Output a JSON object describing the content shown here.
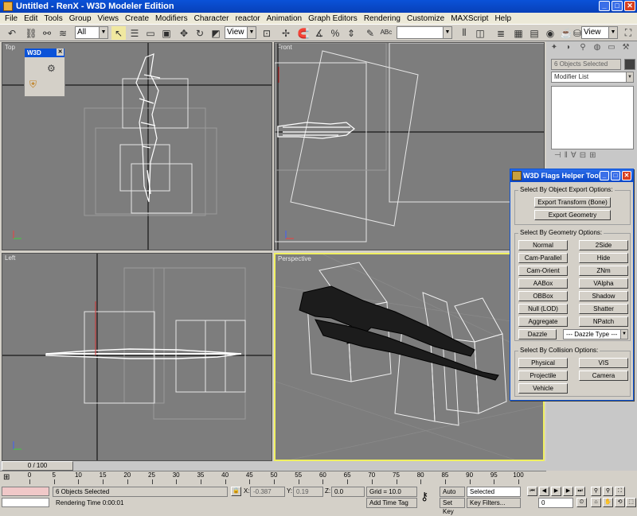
{
  "window": {
    "title": "Untitled - RenX - W3D Modeler Edition"
  },
  "menu": [
    "File",
    "Edit",
    "Tools",
    "Group",
    "Views",
    "Create",
    "Modifiers",
    "Character",
    "reactor",
    "Animation",
    "Graph Editors",
    "Rendering",
    "Customize",
    "MAXScript",
    "Help"
  ],
  "toolbar": {
    "selection_filter": "All",
    "ref_coord": "View",
    "named_sel": "",
    "render_type": "View"
  },
  "viewports": {
    "top": "Top",
    "front": "Front",
    "left": "Left",
    "perspective": "Perspective"
  },
  "w3d_mini": {
    "title": "W3D"
  },
  "command_panel": {
    "selection_label": "6 Objects Selected",
    "modifier_list": "Modifier List"
  },
  "flags_dialog": {
    "title": "W3D Flags Helper Tool",
    "group_export": "Select By Object Export Options:",
    "btn_export_transform": "Export Transform (Bone)",
    "btn_export_geometry": "Export Geometry",
    "group_geometry": "Select By Geometry Options:",
    "geo_buttons": [
      "Normal",
      "2Side",
      "Cam-Parallel",
      "Hide",
      "Cam-Orient",
      "ZNm",
      "AABox",
      "VAlpha",
      "OBBox",
      "Shadow",
      "Null (LOD)",
      "Shatter",
      "Aggregate",
      "NPatch"
    ],
    "btn_dazzle": "Dazzle",
    "dazzle_type": "--- Dazzle Type ---",
    "group_collision": "Select By Collision Options:",
    "col_buttons": [
      "Physical",
      "VIS",
      "Projectile",
      "Camera"
    ],
    "btn_vehicle": "Vehicle"
  },
  "timeline": {
    "frame": "0 / 100",
    "ticks": [
      "0",
      "5",
      "10",
      "15",
      "20",
      "25",
      "30",
      "35",
      "40",
      "45",
      "50",
      "55",
      "60",
      "65",
      "70",
      "75",
      "80",
      "85",
      "90",
      "95",
      "100"
    ]
  },
  "status": {
    "selected": "6 Objects Selected",
    "rendering_time": "Rendering Time  0:00:01",
    "x_label": "X:",
    "x_value": "-0.387",
    "y_label": "Y:",
    "y_value": "0.19",
    "z_label": "Z:",
    "z_value": "0.0",
    "grid": "Grid = 10.0",
    "add_time_tag": "Add Time Tag",
    "auto_key": "Auto Key",
    "auto_key_value": "Selected",
    "set_key": "Set Key",
    "key_filters": "Key Filters...",
    "frame_field": "0"
  }
}
